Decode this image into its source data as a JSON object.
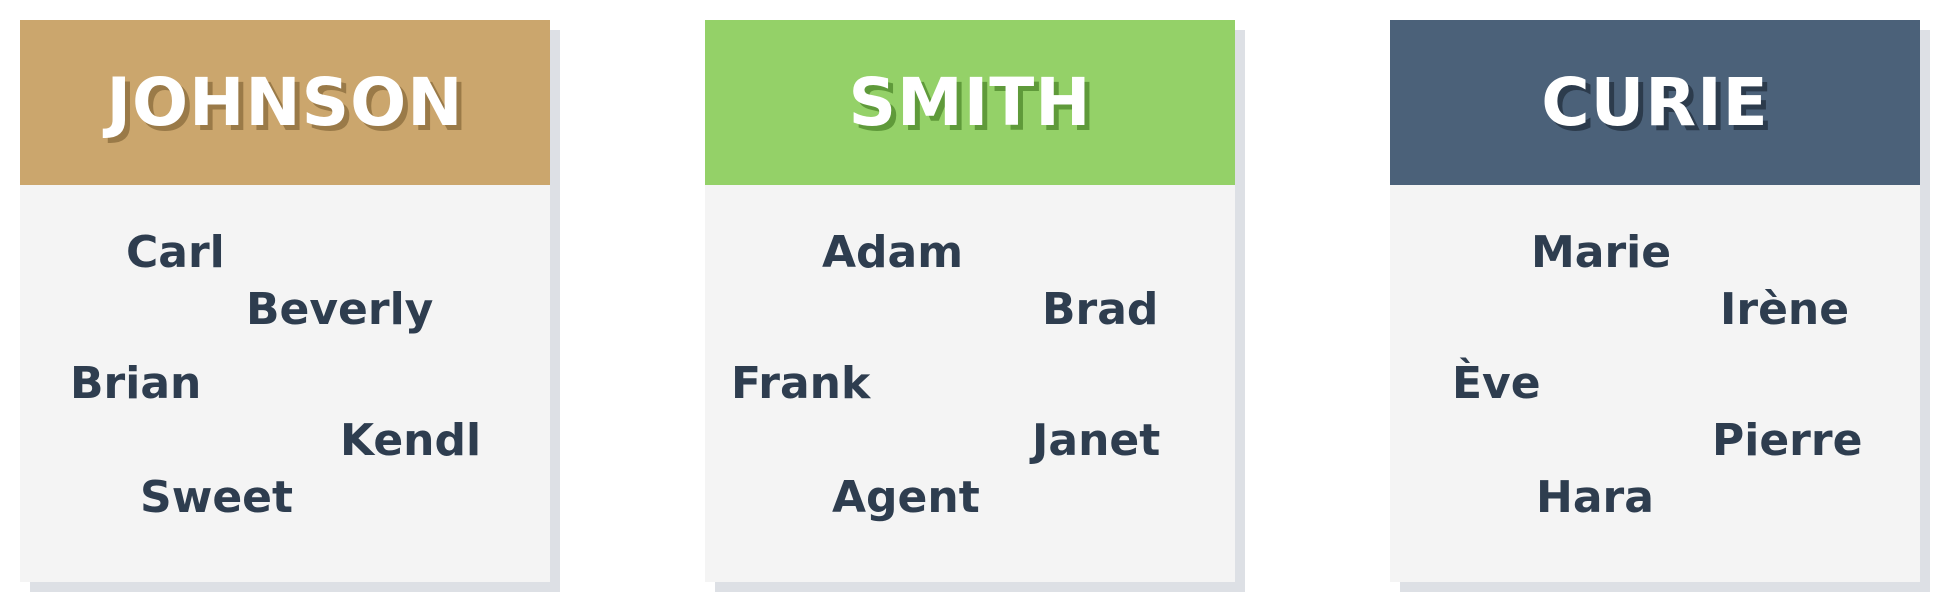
{
  "families": [
    {
      "title": "JOHNSON",
      "header_color": "#cba66d",
      "title_shadow": "#9a7a48",
      "members": [
        "Carl",
        "Beverly",
        "Brian",
        "Kendl",
        "Sweet"
      ]
    },
    {
      "title": "SMITH",
      "header_color": "#94d168",
      "title_shadow": "#5f9a3a",
      "members": [
        "Adam",
        "Brad",
        "Frank",
        "Janet",
        "Agent"
      ]
    },
    {
      "title": "CURIE",
      "header_color": "#4b6179",
      "title_shadow": "#2c3b4c",
      "members": [
        "Marie",
        "Irène",
        "Ève",
        "Pierre",
        "Hara"
      ]
    }
  ]
}
